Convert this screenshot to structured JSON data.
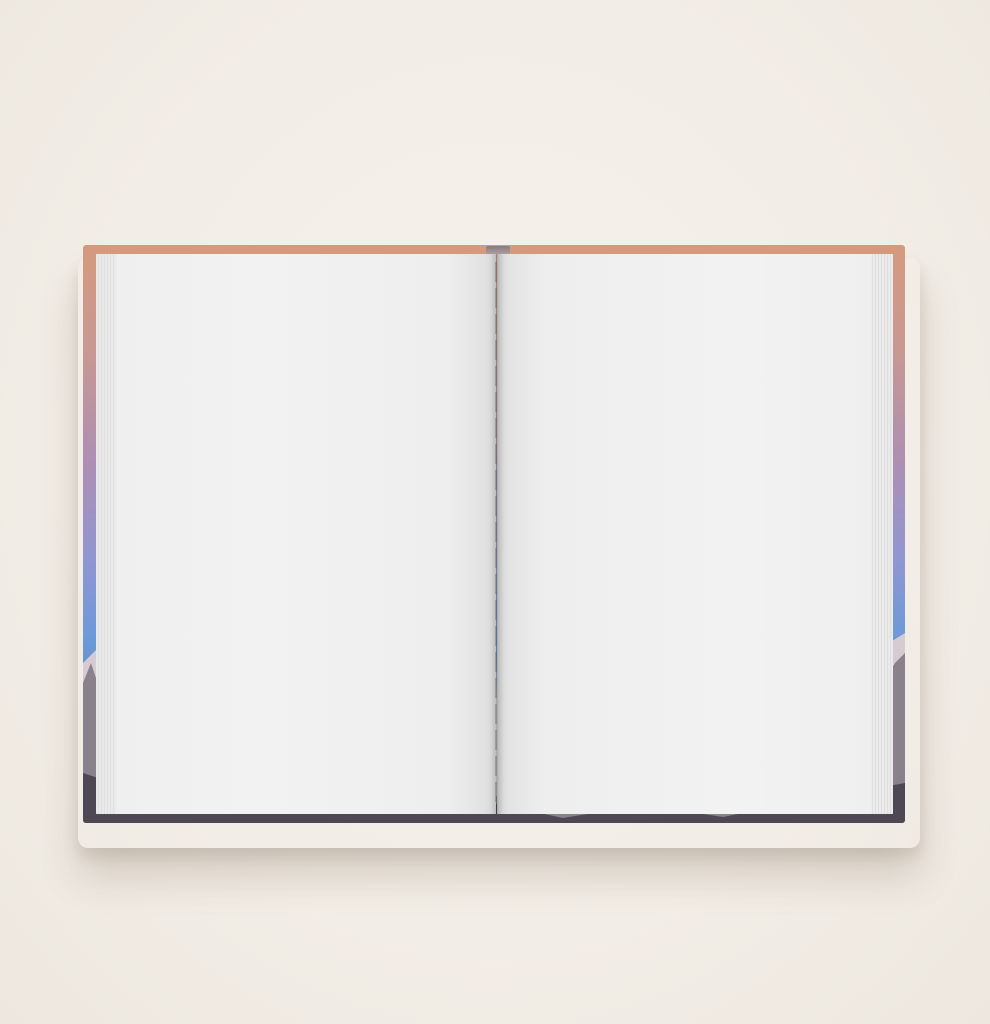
{
  "scene": {
    "subject": "open-blank-hardcover-book",
    "background_color": "#f3eee8",
    "cover_colors": {
      "top": "#d59a7e",
      "middle": "#ad8fb4",
      "sky": "#6c9ad8",
      "snow": "#d8ccd4",
      "rock": "#3d3a45"
    },
    "page_color": "#f0f0f0"
  }
}
